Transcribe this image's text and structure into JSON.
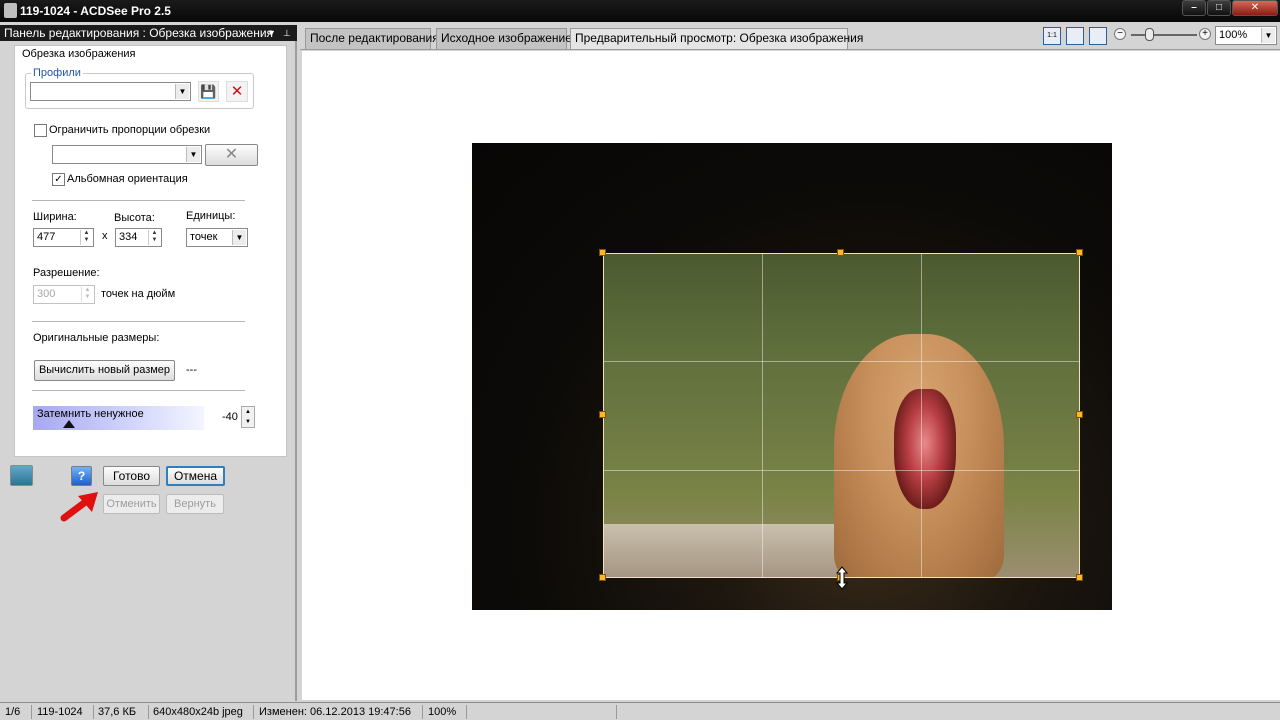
{
  "window": {
    "title": "119-1024 - ACDSee Pro 2.5",
    "minimize_icon": "minimize-icon",
    "maximize_icon": "maximize-icon",
    "close_icon": "close-icon",
    "minimize_glyph": "–",
    "maximize_glyph": "□",
    "close_glyph": "✕"
  },
  "panel": {
    "title": "Панель редактирования : Обрезка изображения",
    "pin_glyph": "▼",
    "pin2_glyph": "⊥",
    "section_title": "Обрезка изображения",
    "profiles": {
      "label": "Профили",
      "value": "",
      "save_icon": "save-icon",
      "delete_icon": "delete-icon",
      "save_glyph": "💾",
      "delete_glyph": "✕"
    },
    "constrain": {
      "label": "Ограничить пропорции  обрезки",
      "checked": false,
      "ratio_value": "",
      "clear_glyph": "✕",
      "landscape_label": "Альбомная ориентация",
      "landscape_checked": true,
      "check_glyph": "✓"
    },
    "size": {
      "width_label": "Ширина:",
      "width_value": "477",
      "x_sign": "x",
      "height_label": "Высота:",
      "height_value": "334",
      "units_label": "Единицы:",
      "units_value": "точек"
    },
    "resolution": {
      "label": "Разрешение:",
      "value": "300",
      "unit": "точек на дюйм"
    },
    "original": {
      "label": "Оригинальные размеры:",
      "button": "Вычислить новый размер",
      "value": "---"
    },
    "darken": {
      "label": "Затемнить ненужное",
      "value": "-40",
      "level": -40
    },
    "buttons": {
      "done": "Готово",
      "cancel": "Отмена",
      "undo": "Отменить",
      "redo": "Вернуть",
      "help_glyph": "?",
      "help_icon": "help-icon",
      "save_full_icon": "save-full-icon"
    }
  },
  "tabs": [
    {
      "label": "После редактирования",
      "active": false
    },
    {
      "label": "Исходное изображение",
      "active": false
    },
    {
      "label": "Предварительный просмотр: Обрезка изображения",
      "active": true
    }
  ],
  "toolbar": {
    "zoom_value": "100%",
    "zoom_level": 100,
    "fit_icon": "actual-size-icon",
    "fit2_icon": "fit-image-icon",
    "fit3_icon": "fit-width-icon",
    "zoom_minus": "−",
    "zoom_plus": "+",
    "actual_glyph": "1:1"
  },
  "status": {
    "index": "1/6",
    "filename": "119-1024",
    "size": "37,6 КБ",
    "dims": "640x480x24b jpeg",
    "modified": "Изменен: 06.12.2013 19:47:56",
    "zoom": "100%"
  }
}
